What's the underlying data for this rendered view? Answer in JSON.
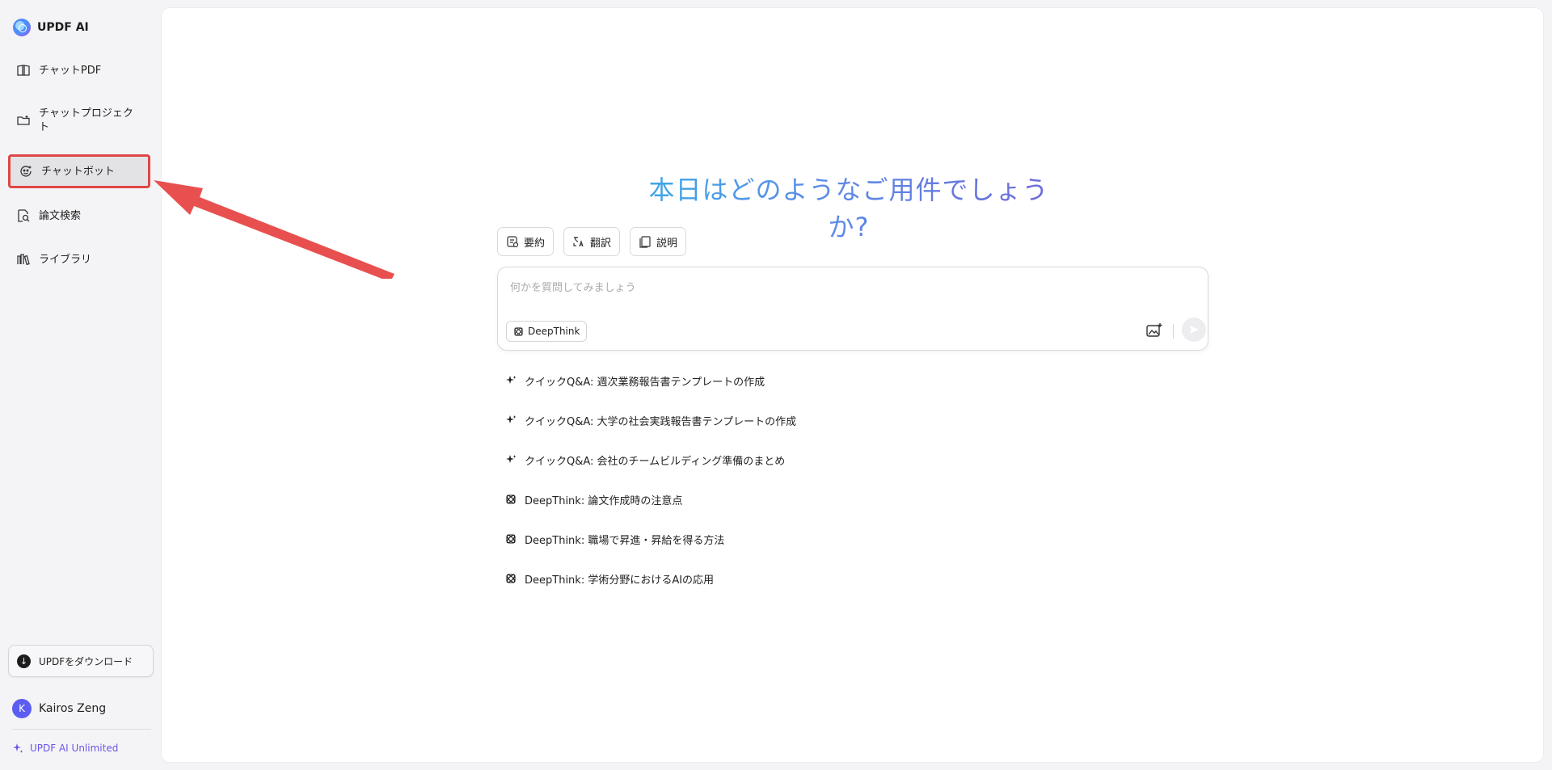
{
  "brand": {
    "name": "UPDF AI"
  },
  "sidebar": {
    "items": [
      {
        "label": "チャットPDF",
        "icon": "book-icon"
      },
      {
        "label": "チャットプロジェクト",
        "icon": "folder-icon"
      },
      {
        "label": "チャットボット",
        "icon": "chatbot-icon",
        "selected": true
      },
      {
        "label": "論文検索",
        "icon": "doc-search-icon"
      },
      {
        "label": "ライブラリ",
        "icon": "library-icon"
      }
    ],
    "download_label": "UPDFをダウンロード",
    "user": {
      "initial": "K",
      "name": "Kairos Zeng"
    },
    "plan_label": "UPDF AI Unlimited"
  },
  "main": {
    "headline": "本日はどのようなご用件でしょうか?",
    "tools": [
      {
        "label": "要約",
        "icon": "summary-icon"
      },
      {
        "label": "翻訳",
        "icon": "translate-icon"
      },
      {
        "label": "説明",
        "icon": "explain-icon"
      }
    ],
    "composer": {
      "placeholder": "何かを質問してみましょう",
      "deepthink_label": "DeepThink"
    },
    "suggestions": [
      {
        "type": "quick",
        "text": "クイックQ&A: 週次業務報告書テンプレートの作成"
      },
      {
        "type": "quick",
        "text": "クイックQ&A: 大学の社会実践報告書テンプレートの作成"
      },
      {
        "type": "quick",
        "text": "クイックQ&A: 会社のチームビルディング準備のまとめ"
      },
      {
        "type": "deepthink",
        "text": "DeepThink: 論文作成時の注意点"
      },
      {
        "type": "deepthink",
        "text": "DeepThink: 職場で昇進・昇給を得る方法"
      },
      {
        "type": "deepthink",
        "text": "DeepThink: 学術分野におけるAIの応用"
      }
    ]
  },
  "colors": {
    "accent": "#6a56e8",
    "highlight_border": "#e04646",
    "arrow": "#e8504f",
    "headline_start": "#3fa6e6",
    "headline_end": "#6e6ad9"
  }
}
